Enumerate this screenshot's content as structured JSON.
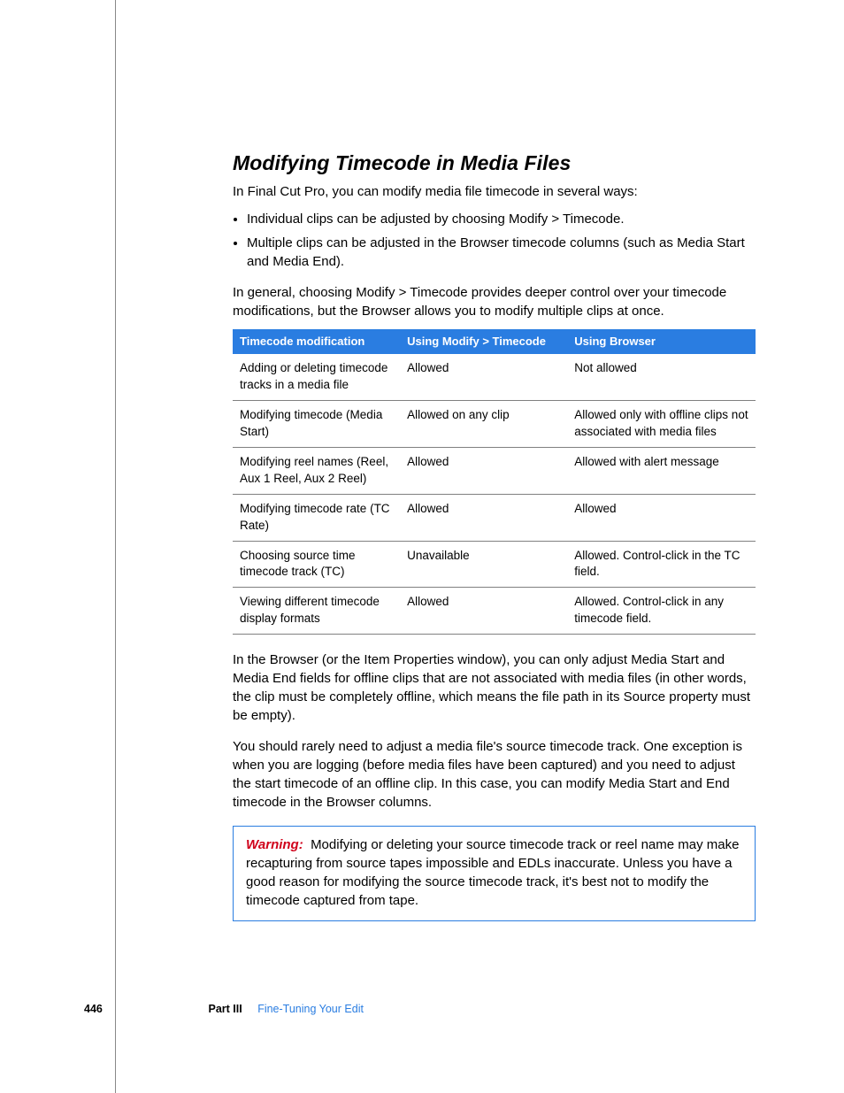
{
  "title": "Modifying Timecode in Media Files",
  "intro": "In Final Cut Pro, you can modify media file timecode in several ways:",
  "bullets": [
    "Individual clips can be adjusted by choosing Modify > Timecode.",
    "Multiple clips can be adjusted in the Browser timecode columns (such as Media Start and Media End)."
  ],
  "para2": "In general, choosing Modify > Timecode provides deeper control over your timecode modifications, but the Browser allows you to modify multiple clips at once.",
  "table": {
    "headers": [
      "Timecode modification",
      "Using Modify > Timecode",
      "Using Browser"
    ],
    "rows": [
      [
        "Adding or deleting timecode tracks in a media file",
        "Allowed",
        "Not allowed"
      ],
      [
        "Modifying timecode (Media Start)",
        "Allowed on any clip",
        "Allowed only with offline clips not associated with media files"
      ],
      [
        "Modifying reel names (Reel, Aux 1 Reel, Aux 2 Reel)",
        "Allowed",
        "Allowed with alert message"
      ],
      [
        "Modifying timecode rate (TC Rate)",
        "Allowed",
        "Allowed"
      ],
      [
        "Choosing source time timecode track (TC)",
        "Unavailable",
        "Allowed. Control-click in the TC field."
      ],
      [
        "Viewing different timecode display formats",
        "Allowed",
        "Allowed. Control-click in any timecode field."
      ]
    ]
  },
  "para3": "In the Browser (or the Item Properties window), you can only adjust Media Start and Media End fields for offline clips that are not associated with media files (in other words, the clip must be completely offline, which means the file path in its Source property must be empty).",
  "para4": "You should rarely need to adjust a media file's source timecode track. One exception is when you are logging (before media files have been captured) and you need to adjust the start timecode of an offline clip. In this case, you can modify Media Start and End timecode in the Browser columns.",
  "warning_label": "Warning:",
  "warning_body": "Modifying or deleting your source timecode track or reel name may make recapturing from source tapes impossible and EDLs inaccurate. Unless you have a good reason for modifying the source timecode track, it's best not to modify the timecode captured from tape.",
  "footer": {
    "page_number": "446",
    "part": "Part III",
    "chapter": "Fine-Tuning Your Edit"
  }
}
